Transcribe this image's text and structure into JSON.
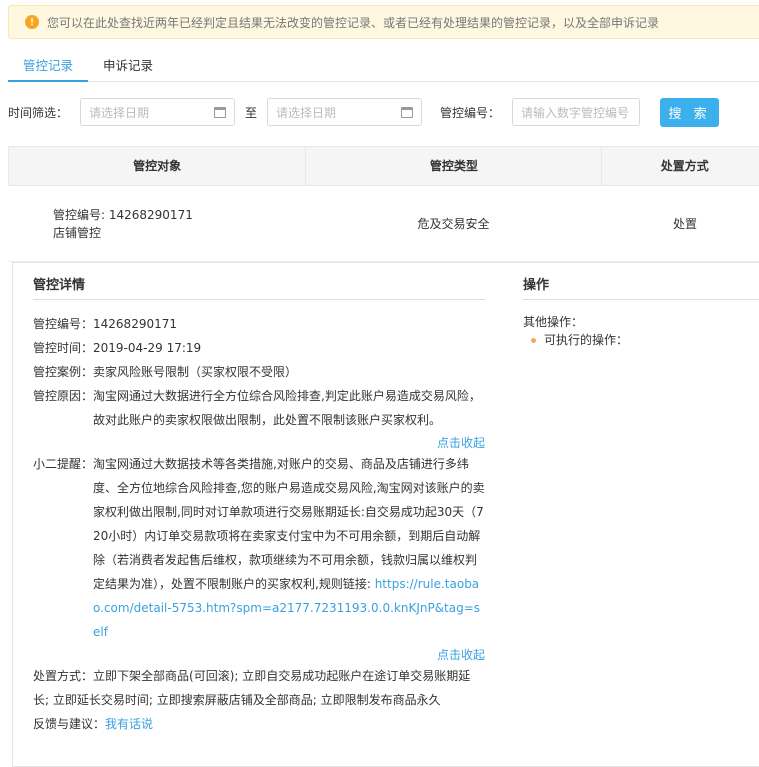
{
  "notice": {
    "icon": "warning-icon",
    "text": "您可以在此处查找近两年已经判定且结果无法改变的管控记录、或者已经有处理结果的管控记录，以及全部申诉记录"
  },
  "tabs": [
    {
      "label": "管控记录",
      "active": true
    },
    {
      "label": "申诉记录",
      "active": false
    }
  ],
  "filters": {
    "time_label": "时间筛选：",
    "start_placeholder": "请选择日期",
    "to_label": "至",
    "end_placeholder": "请选择日期",
    "number_label": "管控编号：",
    "number_placeholder": "请输入数字管控编号",
    "search_label": "搜 索"
  },
  "table": {
    "headers": [
      "管控对象",
      "管控类型",
      "处置方式"
    ],
    "row": {
      "object_line1": "管控编号: 14268290171",
      "object_line2": "店铺管控",
      "type": "危及交易安全",
      "action": "处置"
    }
  },
  "detail": {
    "title": "管控详情",
    "id_label": "管控编号：",
    "id_value": "14268290171",
    "time_label": "管控时间：",
    "time_value": "2019-04-29 17:19",
    "case_label": "管控案例：",
    "case_value": "卖家风险账号限制（买家权限不受限）",
    "reason_label": "管控原因：",
    "reason_value": "淘宝网通过大数据进行全方位综合风险排查,判定此账户易造成交易风险，故对此账户的卖家权限做出限制，此处置不限制该账户买家权利。",
    "collapse1": "点击收起",
    "tip_label": "小二提醒：",
    "tip_value": "淘宝网通过大数据技术等各类措施,对账户的交易、商品及店铺进行多纬度、全方位地综合风险排查,您的账户易造成交易风险,淘宝网对该账户的卖家权利做出限制,同时对订单款项进行交易账期延长:自交易成功起30天（720小时）内订单交易款项将在卖家支付宝中为不可用余额，到期后自动解除（若消费者发起售后维权，款项继续为不可用余额，钱款归属以维权判定结果为准），处置不限制账户的买家权利,规则链接: ",
    "tip_link": "https://rule.taobao.com/detail-5753.htm?spm=a2177.7231193.0.0.knKJnP&tag=self",
    "collapse2": "点击收起",
    "disposal_label": "处置方式：",
    "disposal_value": "立即下架全部商品(可回滚); 立即自交易成功起账户在途订单交易账期延长; 立即延长交易时间; 立即搜索屏蔽店铺及全部商品; 立即限制发布商品永久",
    "feedback_label": "反馈与建议：",
    "feedback_link": "我有话说"
  },
  "operations": {
    "title": "操作",
    "other_label": "其他操作：",
    "executable_label": "可执行的操作："
  }
}
